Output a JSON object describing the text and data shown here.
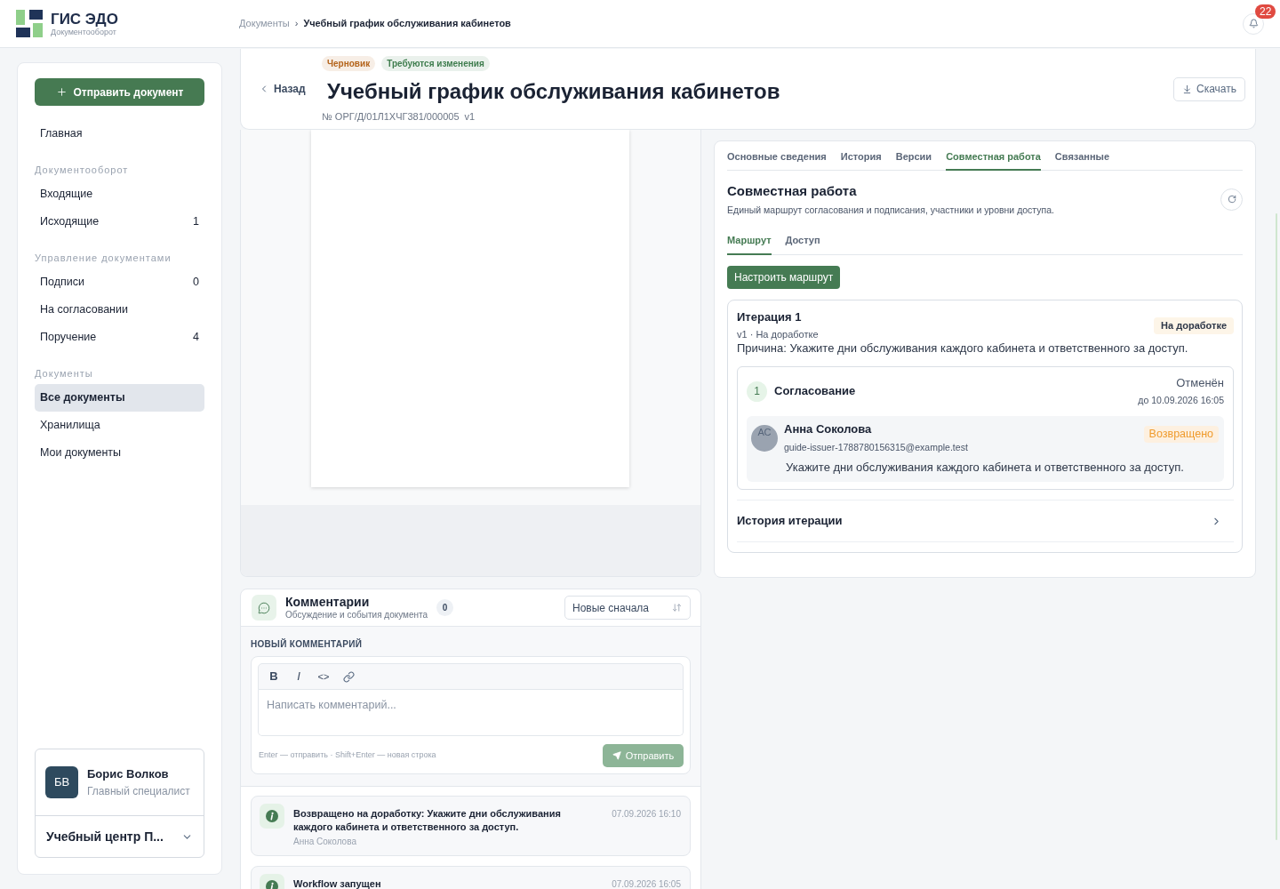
{
  "header": {
    "logo_title": "ГИС ЭДО",
    "logo_subtitle": "Документооборот",
    "breadcrumb": [
      {
        "label": "Документы",
        "current": false
      },
      {
        "label": "Учебный график обслуживания кабинетов",
        "current": true
      }
    ],
    "breadcrumb_separator": "›",
    "notification_count": "22"
  },
  "sidebar": {
    "action_button": "Отправить документ",
    "groups": [
      {
        "items": [
          {
            "label": "Главная",
            "selected": false
          }
        ]
      },
      {
        "title": "Документооборот",
        "items": [
          {
            "label": "Входящие",
            "selected": false
          },
          {
            "label": "Исходящие",
            "count": "1",
            "selected": false
          }
        ]
      },
      {
        "title": "Управление документами",
        "items": [
          {
            "label": "Подписи",
            "count": "0",
            "selected": false
          },
          {
            "label": "На согласовании",
            "selected": false
          },
          {
            "label": "Поручение",
            "count": "4",
            "selected": false
          }
        ]
      },
      {
        "title": "Документы",
        "items": [
          {
            "label": "Все документы",
            "selected": true
          },
          {
            "label": "Хранилища",
            "selected": false
          },
          {
            "label": "Мои документы",
            "selected": false
          }
        ]
      }
    ],
    "user": {
      "initials": "БВ",
      "name": "Борис Волков",
      "role": "Главный специалист",
      "organization": "Учебный центр П..."
    }
  },
  "document": {
    "back_link": "Назад",
    "badges": [
      {
        "label": "Черновик",
        "color": "#b4641c"
      },
      {
        "label": "Требуются изменения",
        "color": "#3f7d4e"
      }
    ],
    "title": "Учебный график обслуживания кабинетов",
    "number": "№ ОРГ/Д/01Л1ХЧГ381/000005",
    "version": "v1",
    "download_button": "Скачать"
  },
  "details": {
    "tabs": [
      {
        "label": "Основные сведения",
        "selected": false
      },
      {
        "label": "История",
        "selected": false
      },
      {
        "label": "Версии",
        "selected": false
      },
      {
        "label": "Совместная работа",
        "selected": true
      },
      {
        "label": "Связанные",
        "selected": false
      }
    ],
    "title": "Совместная работа",
    "description": "Единый маршрут согласования и подписания, участники и уровни доступа.",
    "subtabs": [
      {
        "label": "Маршрут",
        "selected": true
      },
      {
        "label": "Доступ",
        "selected": false
      }
    ],
    "configure_button": "Настроить маршрут",
    "iteration": {
      "title": "Итерация 1",
      "meta": "v1 · На доработке",
      "status": "На доработке",
      "reason": "Причина: Укажите дни обслуживания каждого кабинета и ответственного за доступ.",
      "stages": [
        {
          "number": "1",
          "title": "Согласование",
          "status": "Отменён",
          "deadline": "до 10.09.2026 16:05",
          "participants": [
            {
              "initials": "АС",
              "name": "Анна Соколова",
              "email": "guide-issuer-1788780156315@example.test",
              "status": "Возвращено",
              "comment": "Укажите дни обслуживания каждого кабинета и ответственного за доступ."
            }
          ]
        }
      ],
      "history_link": "История итерации"
    }
  },
  "comments": {
    "title": "Комментарии",
    "subtitle": "Обсуждение и события документа",
    "count": "0",
    "sort": "Новые сначала",
    "new_comment_label": "НОВЫЙ КОММЕНТАРИЙ",
    "toolbar": [
      {
        "kind": "bold",
        "label": "B"
      },
      {
        "kind": "italic",
        "label": "I"
      },
      {
        "kind": "code",
        "label": "<>"
      },
      {
        "kind": "link"
      }
    ],
    "placeholder": "Написать комментарий...",
    "hint": "Enter — отправить · Shift+Enter — новая строка",
    "send_button": {
      "label": "Отправить",
      "disabled": true
    },
    "events": [
      {
        "kind": "info",
        "text": "Возвращено на доработку: Укажите дни обслуживания каждого кабинета и ответственного за доступ.",
        "author": "Анна Соколова",
        "time": "07.09.2026 16:10"
      },
      {
        "kind": "info",
        "text": "Workflow запущен",
        "time": "07.09.2026 16:05"
      }
    ]
  }
}
